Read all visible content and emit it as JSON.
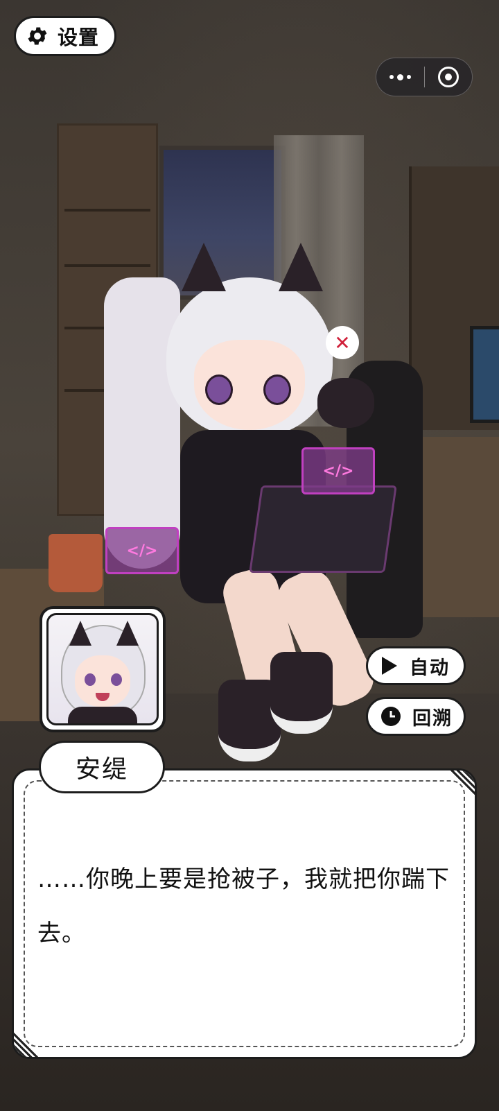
{
  "top_left": {
    "settings_label": "设置",
    "icon": "gear-icon"
  },
  "mini_program_capsule": {
    "more_icon": "more-dots-icon",
    "close_icon": "target-circle-icon"
  },
  "scene": {
    "emote": "✕",
    "holo_panel_1": "</>",
    "holo_panel_2": "</>",
    "laptop_icon": "cat-face-icon"
  },
  "side_buttons": {
    "auto": {
      "label": "自动",
      "icon": "play-icon"
    },
    "backlog": {
      "label": "回溯",
      "icon": "clock-icon"
    }
  },
  "speaker": {
    "name": "安缇",
    "avatar": "character-portrait"
  },
  "dialog": {
    "text": "……你晚上要是抢被子，我就把你踹下去。"
  },
  "colors": {
    "ui_white": "#ffffff",
    "ui_border": "#1c1c1c",
    "accent_pink": "#d040c0"
  }
}
